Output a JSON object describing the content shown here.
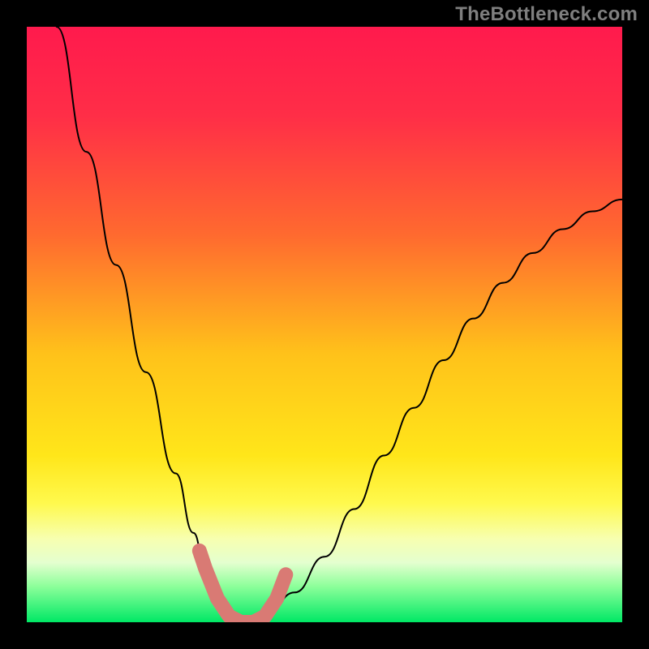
{
  "watermark": {
    "text": "TheBottleneck.com"
  },
  "colors": {
    "gradient_stops": [
      {
        "offset": 0.0,
        "color": "#ff1a4d"
      },
      {
        "offset": 0.15,
        "color": "#ff2e47"
      },
      {
        "offset": 0.35,
        "color": "#ff6a2f"
      },
      {
        "offset": 0.55,
        "color": "#ffc21a"
      },
      {
        "offset": 0.72,
        "color": "#ffe61a"
      },
      {
        "offset": 0.8,
        "color": "#fff94d"
      },
      {
        "offset": 0.86,
        "color": "#f7ffb0"
      },
      {
        "offset": 0.9,
        "color": "#e4ffcf"
      },
      {
        "offset": 0.94,
        "color": "#8cff9a"
      },
      {
        "offset": 1.0,
        "color": "#00e865"
      }
    ],
    "curve": "#000000",
    "marker": "#d97a74",
    "background": "#000000"
  },
  "chart_data": {
    "type": "line",
    "title": "",
    "xlabel": "",
    "ylabel": "",
    "xlim": [
      0,
      100
    ],
    "ylim": [
      0,
      100
    ],
    "grid": false,
    "legend": false,
    "series": [
      {
        "name": "curve",
        "x": [
          5,
          10,
          15,
          20,
          25,
          28,
          30,
          32,
          34,
          36,
          38,
          40,
          45,
          50,
          55,
          60,
          65,
          70,
          75,
          80,
          85,
          90,
          95,
          100
        ],
        "y": [
          100,
          79,
          60,
          42,
          25,
          15,
          9,
          4,
          1,
          0,
          0,
          1,
          5,
          11,
          19,
          28,
          36,
          44,
          51,
          57,
          62,
          66,
          69,
          71
        ]
      }
    ],
    "markers": {
      "name": "highlight-band",
      "x": [
        29,
        30,
        32,
        34,
        36,
        38,
        40,
        42,
        43.5
      ],
      "y": [
        12,
        9,
        4,
        1,
        0,
        0,
        1,
        4,
        8
      ]
    }
  }
}
